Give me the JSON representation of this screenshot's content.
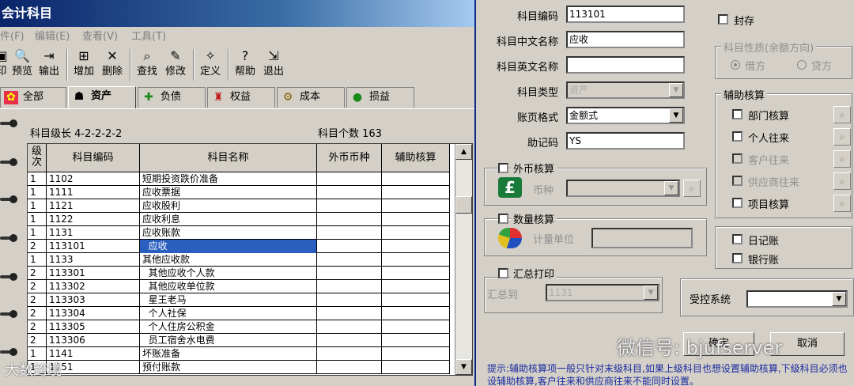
{
  "window": {
    "title": "会计科目"
  },
  "menu": [
    "件(F)",
    "编辑(E)",
    "查看(V)",
    "工具(T)"
  ],
  "toolbar": [
    {
      "label": "印",
      "icon": "print-icon"
    },
    {
      "label": "预览",
      "icon": "preview-icon"
    },
    {
      "label": "输出",
      "icon": "export-icon"
    },
    {
      "label": "增加",
      "icon": "add-icon"
    },
    {
      "label": "删除",
      "icon": "delete-icon"
    },
    {
      "label": "查找",
      "icon": "find-icon"
    },
    {
      "label": "修改",
      "icon": "edit-icon"
    },
    {
      "label": "定义",
      "icon": "define-icon"
    },
    {
      "label": "帮助",
      "icon": "help-icon"
    },
    {
      "label": "退出",
      "icon": "exit-icon"
    }
  ],
  "tabs": [
    {
      "label": "全部",
      "icon": "all-icon",
      "active": false
    },
    {
      "label": "资产",
      "icon": "asset-icon",
      "active": true
    },
    {
      "label": "负债",
      "icon": "liability-icon",
      "active": false
    },
    {
      "label": "权益",
      "icon": "equity-icon",
      "active": false
    },
    {
      "label": "成本",
      "icon": "cost-icon",
      "active": false
    },
    {
      "label": "损益",
      "icon": "profit-loss-icon",
      "active": false
    }
  ],
  "info": {
    "code_length": "科目级长  4-2-2-2-2",
    "count": "科目个数    163"
  },
  "grid": {
    "headers": [
      "级次",
      "科目编码",
      "科目名称",
      "外币币种",
      "辅助核算"
    ],
    "rows": [
      {
        "level": "1",
        "code": "1102",
        "name": "短期投资跌价准备"
      },
      {
        "level": "1",
        "code": "1111",
        "name": "应收票据"
      },
      {
        "level": "1",
        "code": "1121",
        "name": "应收股利"
      },
      {
        "level": "1",
        "code": "1122",
        "name": "应收利息"
      },
      {
        "level": "1",
        "code": "1131",
        "name": "应收账款"
      },
      {
        "level": "2",
        "code": "113101",
        "name": "  应收",
        "selected": true
      },
      {
        "level": "1",
        "code": "1133",
        "name": "其他应收款"
      },
      {
        "level": "2",
        "code": "113301",
        "name": "  其他应收个人款"
      },
      {
        "level": "2",
        "code": "113302",
        "name": "  其他应收单位款"
      },
      {
        "level": "2",
        "code": "113303",
        "name": "  星王老马"
      },
      {
        "level": "2",
        "code": "113304",
        "name": "  个人社保"
      },
      {
        "level": "2",
        "code": "113305",
        "name": "  个人住房公积金"
      },
      {
        "level": "2",
        "code": "113306",
        "name": "  员工宿舍水电费"
      },
      {
        "level": "1",
        "code": "1141",
        "name": "坏账准备"
      },
      {
        "level": "1",
        "code": "1151",
        "name": "预付账款"
      }
    ]
  },
  "form": {
    "code_label": "科目编码",
    "code_value": "113101",
    "cn_name_label": "科目中文名称",
    "cn_name_value": "应收",
    "en_name_label": "科目英文名称",
    "en_name_value": "",
    "type_label": "科目类型",
    "type_value": "资产",
    "format_label": "账页格式",
    "format_value": "金额式",
    "mnemonic_label": "助记码",
    "mnemonic_value": "YS",
    "seal_label": "封存",
    "nature_title": "科目性质(余额方向)",
    "debit_label": "借方",
    "credit_label": "贷方",
    "aux_title": "辅助核算",
    "aux_items": [
      "部门核算",
      "个人往来",
      "客户往来",
      "供应商往来",
      "项目核算"
    ],
    "fx_title": "外币核算",
    "currency_label": "币种",
    "qty_title": "数量核算",
    "unit_label": "计量单位",
    "summary_title": "汇总打印",
    "summary_to_label": "汇总到",
    "summary_to_value": "1131",
    "journal_label": "日记账",
    "bank_label": "银行账",
    "controlled_label": "受控系统",
    "ok_label": "确定",
    "cancel_label": "取消",
    "hint": "提示:辅助核算项一般只针对末级科目,如果上级科目也想设置辅助核算,下级科目必须也设辅助核算,客户往来和供应商往来不能同时设置。"
  },
  "watermark": {
    "text": "微信号: bjufserver",
    "corner": "大数跨境"
  }
}
